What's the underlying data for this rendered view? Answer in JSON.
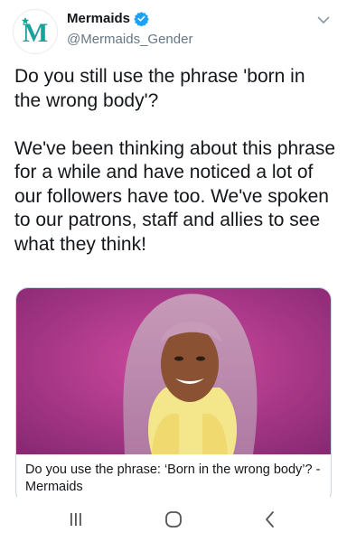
{
  "author": {
    "display_name": "Mermaids",
    "handle": "@Mermaids_Gender",
    "avatar_letter": "M"
  },
  "tweet": {
    "paragraph_1": "Do you still use the phrase 'born in the wrong body'?",
    "paragraph_2": "We've been thinking about this phrase for a while and have noticed a lot of our followers have too. We've spoken to our patrons, staff and allies to see what they think!"
  },
  "card": {
    "title": "Do you use the phrase: ‘Born in the wrong body’? - Mermaids",
    "image_description": "photo-portrait"
  },
  "colors": {
    "brand_teal": "#1aa39a",
    "verified_blue": "#1da1f2",
    "handle_gray": "#657786",
    "card_border": "#ccd6dd"
  },
  "icons": {
    "verified": "verified-badge-icon",
    "more": "chevron-down-icon",
    "nav_recent": "recent-apps-icon",
    "nav_home": "home-icon",
    "nav_back": "back-icon"
  }
}
